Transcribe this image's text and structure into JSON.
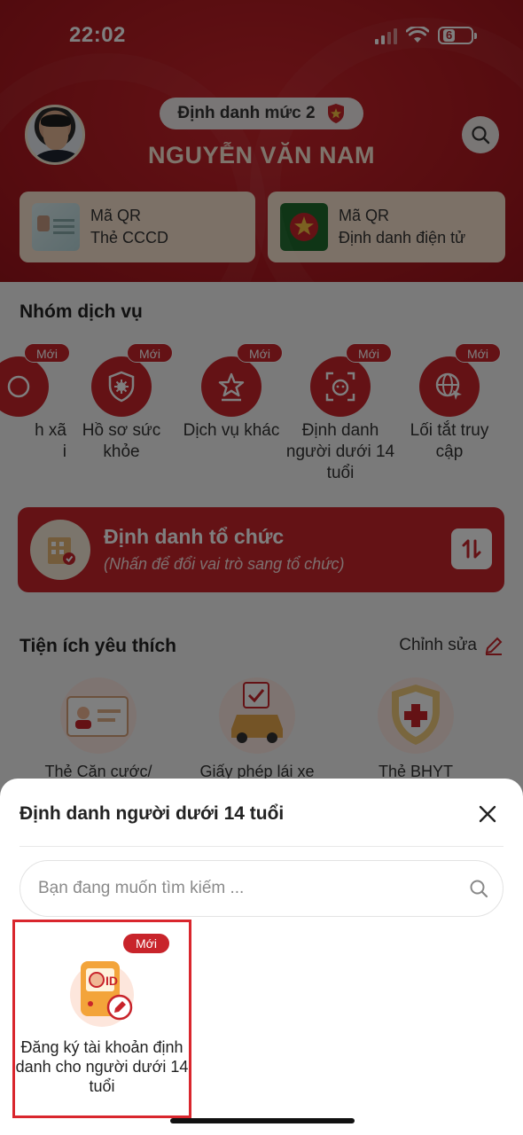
{
  "status_bar": {
    "time": "22:02",
    "battery": "6"
  },
  "header": {
    "level_label": "Định danh mức 2",
    "user_name": "NGUYỄN VĂN NAM",
    "qr_cards": [
      {
        "line1": "Mã QR",
        "line2": "Thẻ CCCD"
      },
      {
        "line1": "Mã QR",
        "line2": "Định danh điện tử"
      }
    ]
  },
  "services": {
    "title": "Nhóm dịch vụ",
    "badge": "Mới",
    "items": [
      {
        "label": "h xã\ni",
        "icon": "partial-service-icon"
      },
      {
        "label": "Hồ sơ sức khỏe",
        "icon": "health-record-icon"
      },
      {
        "label": "Dịch vụ khác",
        "icon": "star-service-icon"
      },
      {
        "label": "Định danh người dưới 14 tuổi",
        "icon": "child-id-icon"
      },
      {
        "label": "Lối tắt truy cập",
        "icon": "globe-shortcut-icon"
      }
    ]
  },
  "org_banner": {
    "title": "Định danh tổ chức",
    "subtitle": "(Nhấn để đổi vai trò sang tổ chức)"
  },
  "favorites": {
    "title": "Tiện ích yêu thích",
    "edit_label": "Chỉnh sửa",
    "items": [
      {
        "label": "Thẻ Căn cước/"
      },
      {
        "label": "Giấy phép lái xe"
      },
      {
        "label": "Thẻ BHYT"
      }
    ]
  },
  "sheet": {
    "title": "Định danh người dưới 14 tuổi",
    "search_placeholder": "Bạn đang muốn tìm kiếm ...",
    "tile": {
      "badge": "Mới",
      "label": "Đăng ký tài khoản định danh cho người dưới 14 tuổi"
    }
  },
  "colors": {
    "brand_red": "#c8242b",
    "cream": "#f9e3cf"
  }
}
